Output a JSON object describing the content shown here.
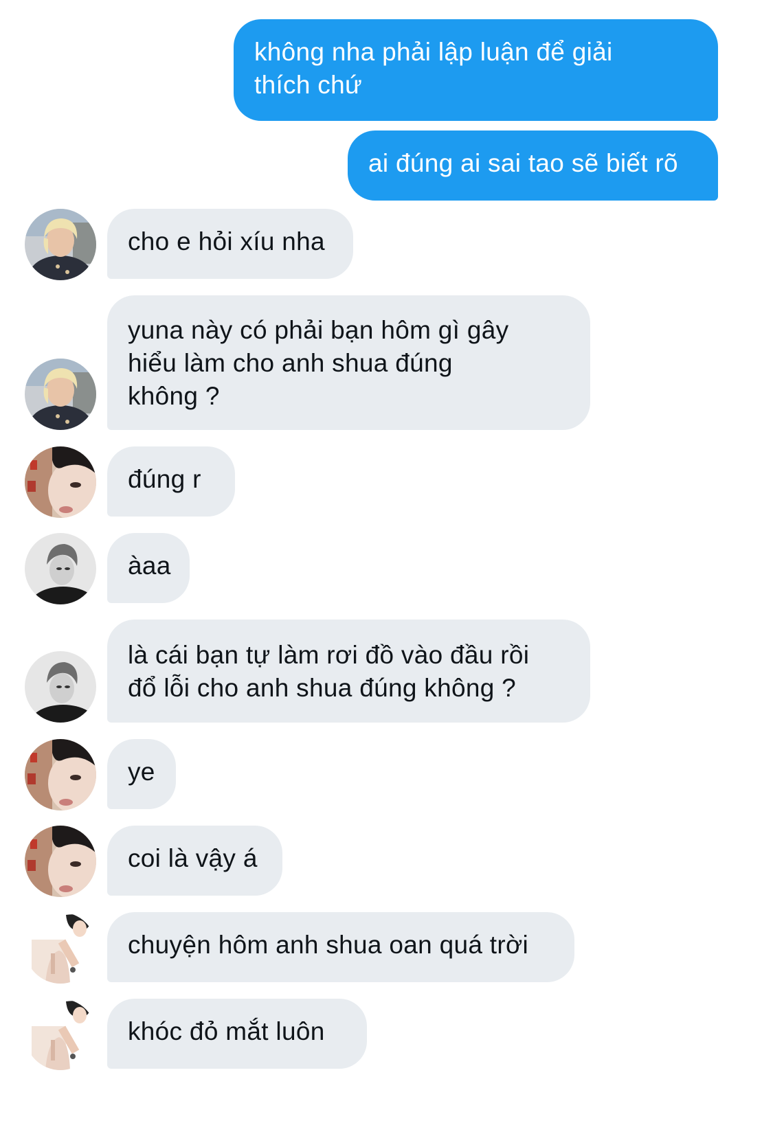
{
  "messages": [
    {
      "side": "out",
      "text": "không nha phải lập luận để giải\nthích chứ"
    },
    {
      "side": "out",
      "text": "ai đúng ai sai tao sẽ biết rõ"
    },
    {
      "side": "in",
      "avatar": "blond-user-avatar",
      "text": "cho e hỏi xíu nha"
    },
    {
      "side": "in",
      "avatar": "blond-user-avatar",
      "text": "yuna này có phải bạn hôm gì gây\nhiểu làm cho anh shua đúng\nkhông ?"
    },
    {
      "side": "in",
      "avatar": "closeup-user-avatar",
      "text": "đúng r"
    },
    {
      "side": "in",
      "avatar": "monochrome-user-avatar",
      "text": "àaa"
    },
    {
      "side": "in",
      "avatar": "monochrome-user-avatar",
      "text": "là cái bạn tự làm rơi đồ vào đầu rồi\nđổ lỗi cho anh shua đúng không ?"
    },
    {
      "side": "in",
      "avatar": "closeup-user-avatar",
      "text": "ye"
    },
    {
      "side": "in",
      "avatar": "closeup-user-avatar",
      "text": "coi là vậy á"
    },
    {
      "side": "in",
      "avatar": "mirror-user-avatar",
      "text": "chuyện hôm anh shua oan quá trời"
    },
    {
      "side": "in",
      "avatar": "mirror-user-avatar",
      "text": "khóc đỏ mắt luôn"
    }
  ],
  "colors": {
    "outgoing_bubble": "#1d9bf0",
    "incoming_bubble": "#e8ecf0",
    "outgoing_text": "#ffffff",
    "incoming_text": "#0f1419"
  }
}
